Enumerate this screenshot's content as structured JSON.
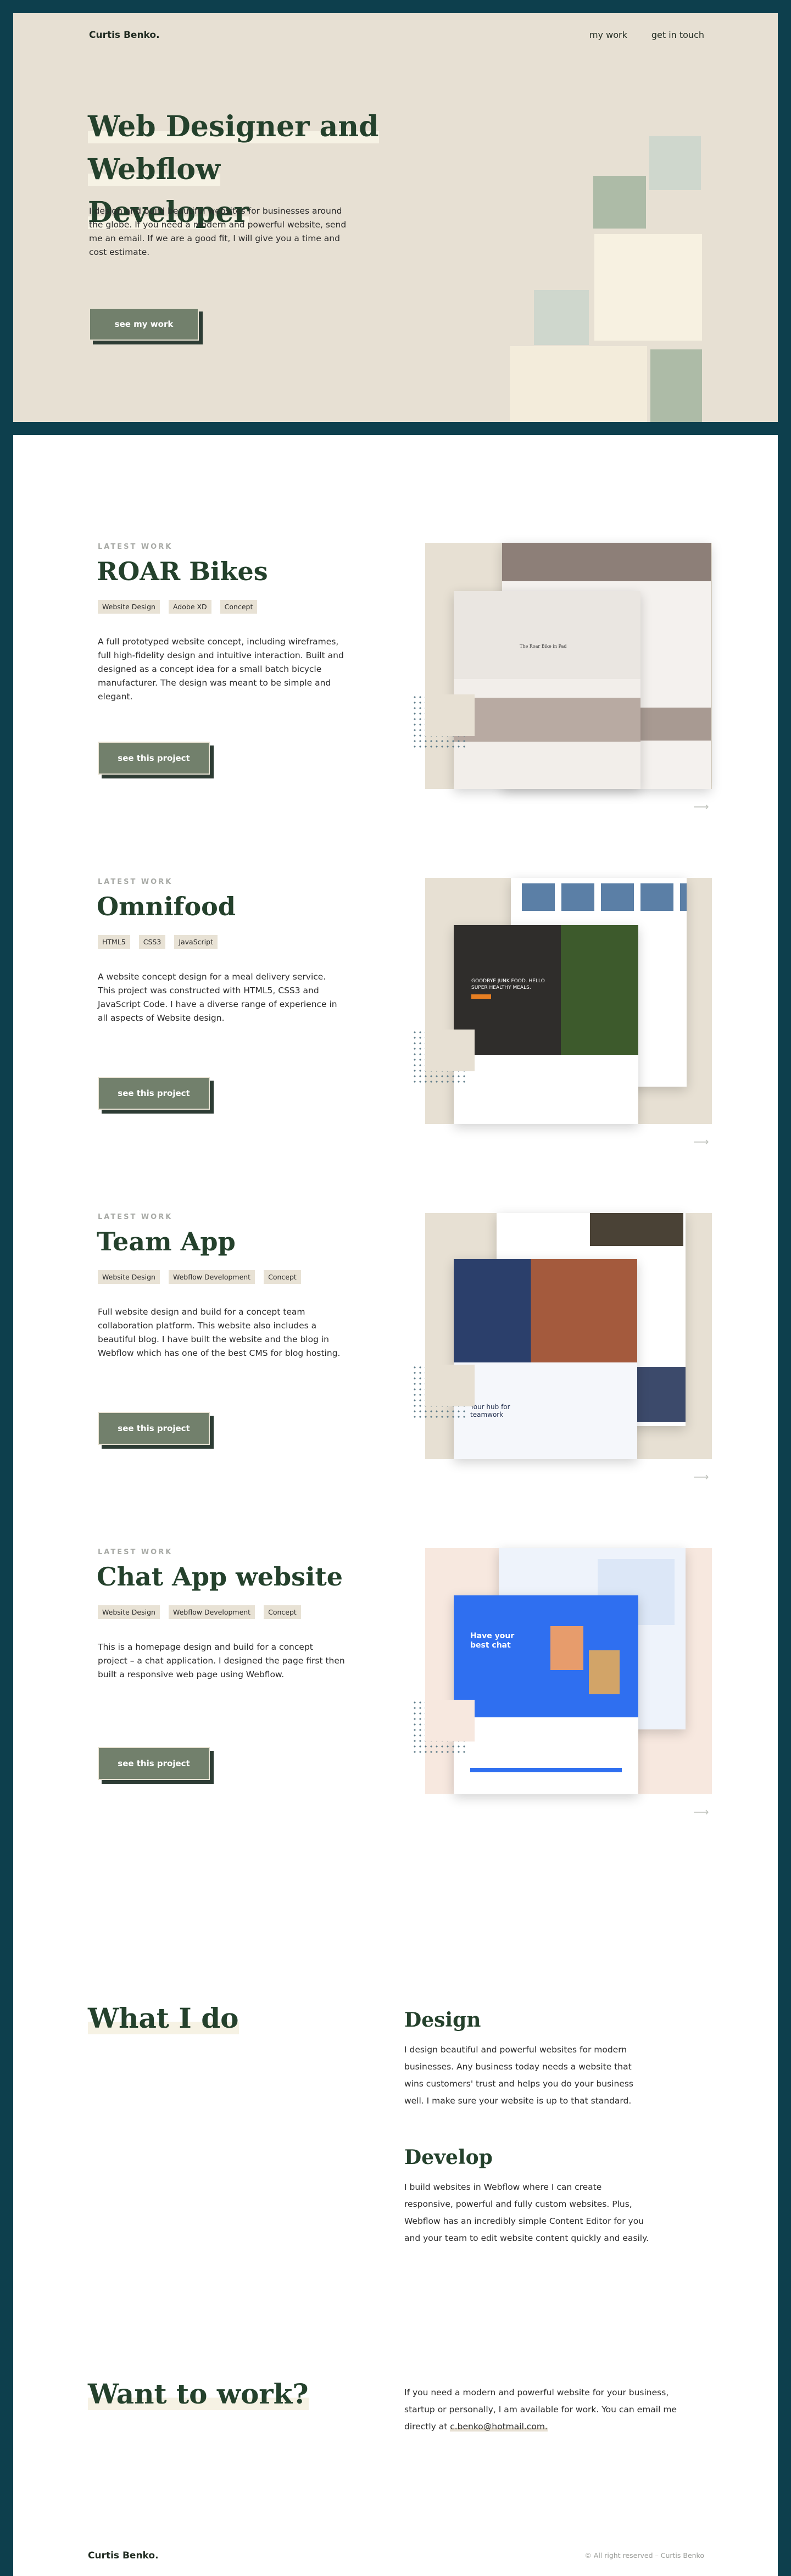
{
  "nav": {
    "logo": "Curtis Benko.",
    "links": [
      "my work",
      "get in touch"
    ]
  },
  "hero": {
    "title_line1": "Web Designer and Webflow",
    "title_line2": "Developer",
    "description": "I design and build beautiful websites for businesses around the globe. If you need a modern and powerful website, send me an email. If we are a good fit, I will give you a time and cost estimate.",
    "button": "see my work"
  },
  "projects": [
    {
      "eyebrow": "LATEST WORK",
      "title": "ROAR Bikes",
      "tags": [
        "Website Design",
        "Adobe XD",
        "Concept"
      ],
      "description": "A full prototyped website concept, including wireframes, full high-fidelity design and intuitive interaction. Built and designed as a concept idea for a small batch bicycle manufacturer. The design was meant to be simple and elegant.",
      "button": "see this project",
      "mock_text": "The Roar Bike in Pad"
    },
    {
      "eyebrow": "LATEST WORK",
      "title": "Omnifood",
      "tags": [
        "HTML5",
        "CSS3",
        "JavaScript"
      ],
      "description": "A website concept design for a meal delivery service. This project was constructed with HTML5, CSS3 and JavaScript Code. I have a diverse range of experience in all aspects of Website design.",
      "button": "see this project",
      "mock_text": "GOODBYE JUNK FOOD. HELLO SUPER HEALTHY MEALS."
    },
    {
      "eyebrow": "LATEST WORK",
      "title": "Team App",
      "tags": [
        "Website Design",
        "Webflow Development",
        "Concept"
      ],
      "description": "Full website design and build for a concept team collaboration platform. This website also includes a beautiful blog. I have built the website and the blog in Webflow which has one of the best CMS for blog hosting.",
      "button": "see this project",
      "mock_text": "Your hub for teamwork"
    },
    {
      "eyebrow": "LATEST WORK",
      "title": "Chat App website",
      "tags": [
        "Website Design",
        "Webflow Development",
        "Concept"
      ],
      "description": "This is a homepage design and build for a concept project – a chat application. I designed the page first then built a responsive web page using Webflow.",
      "button": "see this project",
      "mock_text": "Have your best chat"
    }
  ],
  "what_i_do": {
    "title": "What I do",
    "design_title": "Design",
    "design_text": "I design beautiful and powerful websites for modern businesses. Any business today needs a website that wins customers' trust and helps you do your business well. I make sure your website is up to that standard.",
    "develop_title": "Develop",
    "develop_text": "I build websites in Webflow where I can create responsive, powerful and fully custom websites. Plus, Webflow has an incredibly simple Content Editor for you and your team to edit website content quickly and easily."
  },
  "contact": {
    "title": "Want to work?",
    "text": "If you need a modern and powerful website for your business, startup or personally, I am available for work. You can email me directly at",
    "email": "c.benko@hotmail.com."
  },
  "footer": {
    "logo": "Curtis Benko.",
    "copyright": "© All right reserved – Curtis Benko"
  },
  "colors": {
    "frame": "#0d3f4d",
    "hero_bg": "#e7e0d3",
    "heading": "#24412c",
    "button": "#72806c"
  }
}
